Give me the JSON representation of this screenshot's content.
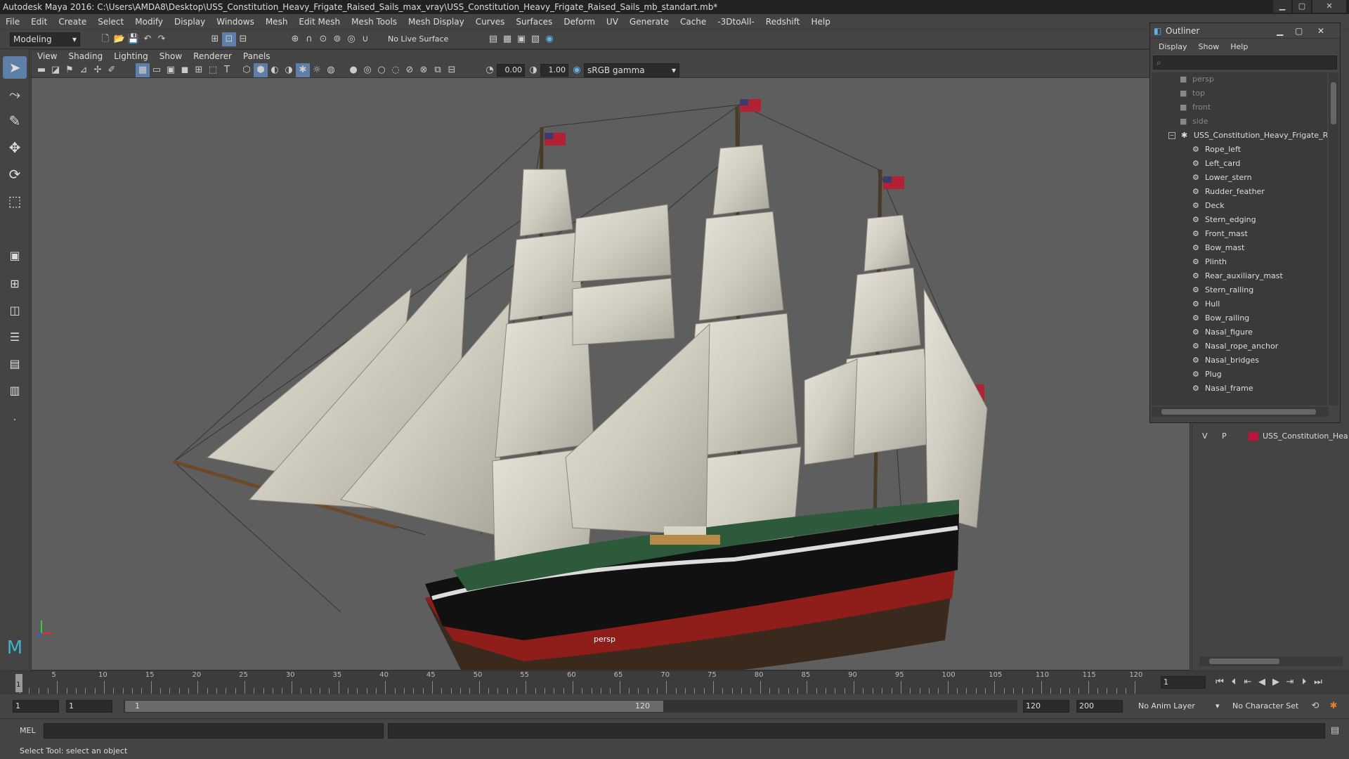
{
  "window": {
    "title": "Autodesk Maya 2016: C:\\Users\\AMDA8\\Desktop\\USS_Constitution_Heavy_Frigate_Raised_Sails_max_vray\\USS_Constitution_Heavy_Frigate_Raised_Sails_mb_standart.mb*"
  },
  "menubar": [
    "File",
    "Edit",
    "Create",
    "Select",
    "Modify",
    "Display",
    "Windows",
    "Mesh",
    "Edit Mesh",
    "Mesh Tools",
    "Mesh Display",
    "Curves",
    "Surfaces",
    "Deform",
    "UV",
    "Generate",
    "Cache",
    "-3DtoAll-",
    "Redshift",
    "Help"
  ],
  "statusline": {
    "mode": "Modeling",
    "live_surface": "No Live Surface"
  },
  "viewport": {
    "menu": [
      "View",
      "Shading",
      "Lighting",
      "Show",
      "Renderer",
      "Panels"
    ],
    "exposure": "0.00",
    "gamma": "1.00",
    "color_space": "sRGB gamma",
    "camera_label": "persp"
  },
  "outliner": {
    "title": "Outliner",
    "menu": [
      "Display",
      "Show",
      "Help"
    ],
    "cameras": [
      "persp",
      "top",
      "front",
      "side"
    ],
    "root": "USS_Constitution_Heavy_Frigate_Ra",
    "children": [
      "Rope_left",
      "Left_card",
      "Lower_stern",
      "Rudder_feather",
      "Deck",
      "Stern_edging",
      "Front_mast",
      "Bow_mast",
      "Plinth",
      "Rear_auxiliary_mast",
      "Stern_railing",
      "Hull",
      "Bow_railing",
      "Nasal_figure",
      "Nasal_rope_anchor",
      "Nasal_bridges",
      "Plug",
      "Nasal_frame"
    ]
  },
  "channel_box": {
    "v": "V",
    "p": "P",
    "layer_name": "USS_Constitution_Hea",
    "layer_color": "#c0143c"
  },
  "timeline": {
    "ticks": [
      "5",
      "10",
      "15",
      "20",
      "25",
      "30",
      "35",
      "40",
      "45",
      "50",
      "55",
      "60",
      "65",
      "70",
      "75",
      "80",
      "85",
      "90",
      "95",
      "100",
      "105",
      "110",
      "115",
      "120"
    ],
    "current_frame": "1",
    "start_marker": "1"
  },
  "range": {
    "start": "1",
    "playback_start": "1",
    "slider_start": "1",
    "slider_end": "120",
    "playback_end": "120",
    "end": "200",
    "anim_layer": "No Anim Layer",
    "character_set": "No Character Set"
  },
  "cmdline": {
    "label": "MEL"
  },
  "helpline": {
    "text": "Select Tool: select an object"
  },
  "colors": {
    "hull_red": "#8f1e1a",
    "sail": "#d8d4c8",
    "viewport_bg": "#5e5e5e"
  }
}
